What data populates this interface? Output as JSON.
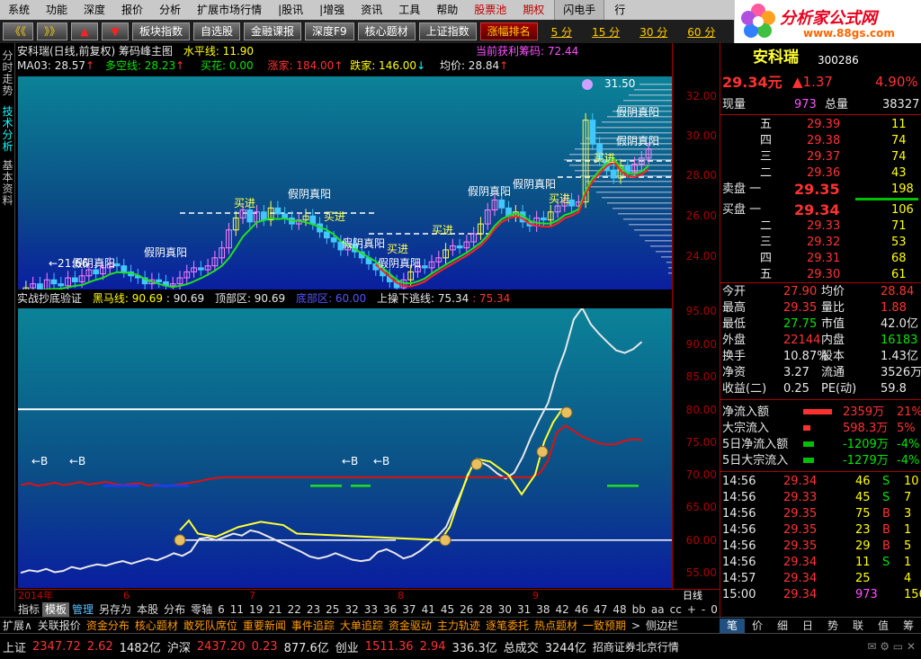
{
  "menu": [
    "系统",
    "功能",
    "深度",
    "报价",
    "分析",
    "扩展市场行情",
    "|股讯",
    "|增强",
    "资讯",
    "工具",
    "帮助",
    "股票池",
    "期权",
    "闪电手",
    "行"
  ],
  "toolbar": {
    "back": "《《",
    "fwd": "》》",
    "up": "▲",
    "down": "▼",
    "btns": [
      "板块指数",
      "自选股",
      "金融课报",
      "深度F9",
      "核心题材",
      "上证指数",
      "涨幅排名"
    ],
    "periods": [
      "5 分",
      "15 分",
      "30 分",
      "60 分"
    ]
  },
  "logo": {
    "title": "分析家公式网",
    "url": "www.88gs.com"
  },
  "left_tabs": [
    "分时走势",
    "技术分析",
    "基本资料"
  ],
  "chart1": {
    "title": "安科瑞(日线,前复权) 筹码峰主图",
    "hline": "水平线: 11.90",
    "profit": "当前获利筹码: 72.44",
    "ma03": "MA03: 28.57",
    "duokong": "多空线: 28.23",
    "maihua": "买花: 0.00",
    "zhangjia": "涨家: 184.00",
    "diejia": "跌家: 146.00",
    "junjia": "均价: 28.84",
    "peak": "31.50",
    "low": "←21.66",
    "yticks": [
      "32.00",
      "30.00",
      "28.00",
      "26.00",
      "24.00",
      "22.00"
    ]
  },
  "chart2": {
    "title": "实战抄底验证",
    "heima": "黑马线: 90.69",
    "heima2": ": 90.69",
    "dingbu": "顶部区: 90.69",
    "dibu": "底部区: 60.00",
    "shangcao": "上操下逃线: 75.34",
    "shangcao2": ": 75.34",
    "yticks": [
      "95.00",
      "90.00",
      "85.00",
      "80.00",
      "75.00",
      "70.00",
      "65.00",
      "60.00",
      "55.00"
    ],
    "b_marks": [
      "←B",
      "←B",
      "←B",
      "←B"
    ]
  },
  "signals": {
    "buy": "买进",
    "doji": "假阴真阳"
  },
  "xaxis": {
    "labels": [
      "2014年",
      "6",
      "7",
      "8",
      "9"
    ],
    "period": "日线"
  },
  "bottom_tabs": [
    "指标",
    "模板",
    "管理",
    "另存为",
    "本股",
    "分布",
    "零轴",
    "6",
    "11",
    "19",
    "21",
    "22",
    "23",
    "25",
    "32",
    "33",
    "36",
    "37",
    "41",
    "45",
    "26",
    "28",
    "30",
    "31",
    "38",
    "42",
    "46",
    "47",
    "48",
    "bb",
    "aa",
    "cc",
    "+",
    "-",
    "0"
  ],
  "news_tabs": [
    "扩展∧",
    "关联报价",
    "资金分布",
    "核心题材",
    "敢死队席位",
    "重要新闻",
    "事件追踪",
    "大单追踪",
    "资金驱动",
    "主力轨迹",
    "逐笔委托",
    "热点题材",
    "一致预期",
    ">",
    "侧边栏"
  ],
  "quote": {
    "name": "安科瑞",
    "code": "300286",
    "price": "29.34元",
    "change": "▲1.37",
    "pct": "4.90%",
    "xianliang_label": "现量",
    "xianliang": "973",
    "zongliang_label": "总量",
    "zongliang": "38327",
    "asks": [
      {
        "l": "五",
        "p": "29.39",
        "v": "11"
      },
      {
        "l": "四",
        "p": "29.38",
        "v": "74"
      },
      {
        "l": "三",
        "p": "29.37",
        "v": "74"
      },
      {
        "l": "二",
        "p": "29.36",
        "v": "43"
      },
      {
        "l": "卖盘  一",
        "p": "29.35",
        "v": "198"
      }
    ],
    "bids": [
      {
        "l": "买盘  一",
        "p": "29.34",
        "v": "106"
      },
      {
        "l": "二",
        "p": "29.33",
        "v": "71"
      },
      {
        "l": "三",
        "p": "29.32",
        "v": "53"
      },
      {
        "l": "四",
        "p": "29.31",
        "v": "68"
      },
      {
        "l": "五",
        "p": "29.30",
        "v": "61"
      }
    ],
    "stats": [
      {
        "a": "今开",
        "b": "27.90",
        "c": "均价",
        "d": "28.84"
      },
      {
        "a": "最高",
        "b": "29.35",
        "c": "量比",
        "d": "1.88"
      },
      {
        "a": "最低",
        "b": "27.75",
        "c": "市值",
        "d": "42.0亿"
      },
      {
        "a": "外盘",
        "b": "22144",
        "c": "内盘",
        "d": "16183"
      },
      {
        "a": "换手",
        "b": "10.87%",
        "c": "股本",
        "d": "1.43亿"
      },
      {
        "a": "净资",
        "b": "3.27",
        "c": "流通",
        "d": "3526万"
      },
      {
        "a": "收益(二)",
        "b": "0.25",
        "c": "PE(动)",
        "d": "59.8"
      }
    ],
    "flows": [
      {
        "a": "净流入额",
        "b": "2359万",
        "c": "21%"
      },
      {
        "a": "大宗流入",
        "b": "598.3万",
        "c": "5%"
      },
      {
        "a": "5日净流入额",
        "b": "-1209万",
        "c": "-4%"
      },
      {
        "a": "5日大宗流入",
        "b": "-1279万",
        "c": "-4%"
      }
    ],
    "ticks": [
      {
        "t": "14:56",
        "p": "29.34",
        "v": "46",
        "s": "S",
        "n": "10"
      },
      {
        "t": "14:56",
        "p": "29.33",
        "v": "45",
        "s": "S",
        "n": "7"
      },
      {
        "t": "14:56",
        "p": "29.35",
        "v": "75",
        "s": "B",
        "n": "3"
      },
      {
        "t": "14:56",
        "p": "29.35",
        "v": "23",
        "s": "B",
        "n": "1"
      },
      {
        "t": "14:56",
        "p": "29.35",
        "v": "29",
        "s": "B",
        "n": "5"
      },
      {
        "t": "14:56",
        "p": "29.34",
        "v": "11",
        "s": "S",
        "n": "1"
      },
      {
        "t": "14:57",
        "p": "29.34",
        "v": "25",
        "s": "",
        "n": "4"
      },
      {
        "t": "15:00",
        "p": "29.34",
        "v": "973",
        "s": "",
        "n": "156"
      }
    ]
  },
  "right_tabs": [
    "笔",
    "价",
    "细",
    "日",
    "势",
    "联",
    "值",
    "筹"
  ],
  "status": {
    "sh_label": "上证",
    "sh": "2347.72",
    "sh_chg": "2.62",
    "sh_amt": "1482亿",
    "hs_label": "沪深",
    "hs": "2437.20",
    "hs_chg": "0.23",
    "hs_amt": "877.6亿",
    "cy_label": "创业",
    "cy": "1511.36",
    "cy_chg": "2.94",
    "cy_amt": "336.3亿",
    "total_label": "总成交",
    "total": "3244亿",
    "broker": "招商证券北京行情"
  },
  "colors": {
    "up": "#ff3232",
    "down": "#00e600",
    "bg": "#000000",
    "accent": "#ffff00"
  }
}
